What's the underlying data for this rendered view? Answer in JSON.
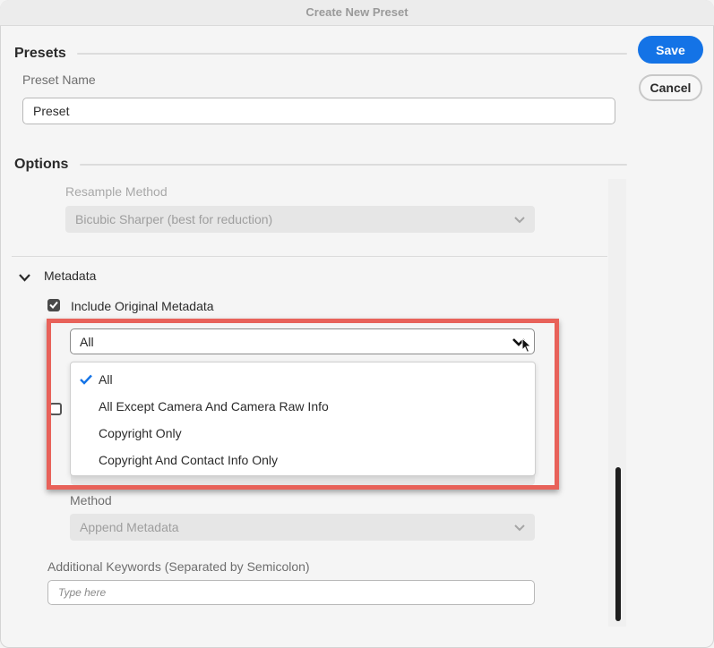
{
  "window": {
    "title": "Create New Preset"
  },
  "actions": {
    "save_label": "Save",
    "cancel_label": "Cancel"
  },
  "presets": {
    "heading": "Presets",
    "name_label": "Preset Name",
    "name_value": "Preset"
  },
  "options": {
    "heading": "Options",
    "resample_label": "Resample Method",
    "resample_value": "Bicubic Sharper (best for reduction)"
  },
  "metadata": {
    "heading": "Metadata",
    "include_original_label": "Include Original Metadata",
    "include_original_checked": true,
    "include_select_value": "All",
    "include_select_options": [
      "All",
      "All Except Camera And Camera Raw Info",
      "Copyright Only",
      "Copyright And Contact Info Only"
    ],
    "selected_option": "All",
    "method_label": "Method",
    "method_value": "Append Metadata",
    "keywords_label": "Additional Keywords (Separated by Semicolon)",
    "keywords_placeholder": "Type here"
  },
  "colors": {
    "accent": "#1473e6",
    "highlight_border": "#e8625a"
  }
}
